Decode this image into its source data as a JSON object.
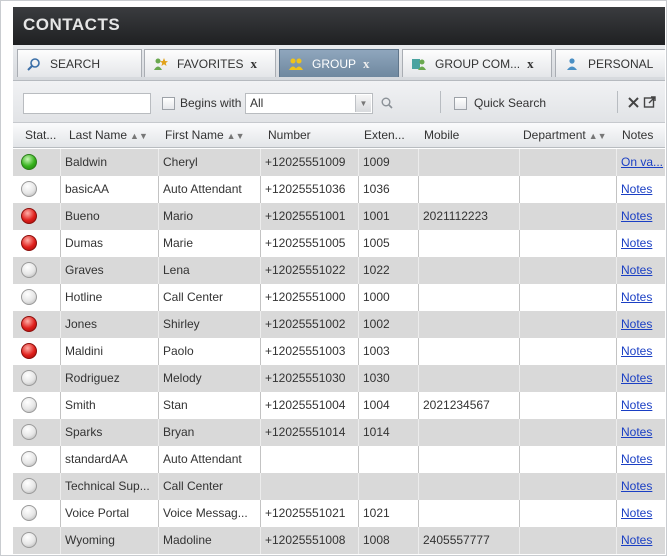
{
  "panel": {
    "title": "CONTACTS"
  },
  "tabs": [
    {
      "label": "SEARCH",
      "icon": "search-icon",
      "closable": false
    },
    {
      "label": "FAVORITES",
      "icon": "favorites-icon",
      "closable": true
    },
    {
      "label": "GROUP",
      "icon": "group-icon",
      "closable": true
    },
    {
      "label": "GROUP COM...",
      "icon": "group-common-icon",
      "closable": true
    },
    {
      "label": "PERSONAL",
      "icon": "personal-icon",
      "closable": false
    }
  ],
  "tab_close_glyph": "x",
  "toolbar": {
    "filter_value": "",
    "begins_with_label": "Begins with",
    "begins_with_value": "All",
    "quick_search_label": "Quick Search"
  },
  "columns": {
    "status": "Stat...",
    "last_name": "Last Name",
    "first_name": "First Name",
    "number": "Number",
    "extension": "Exten...",
    "mobile": "Mobile",
    "department": "Department",
    "notes": "Notes"
  },
  "rows": [
    {
      "status": "green",
      "last": "Baldwin",
      "first": "Cheryl",
      "number": "+12025551009",
      "ext": "1009",
      "mobile": "",
      "dept": "",
      "notes": "On va..."
    },
    {
      "status": "grey",
      "last": "basicAA",
      "first": "Auto Attendant",
      "number": "+12025551036",
      "ext": "1036",
      "mobile": "",
      "dept": "",
      "notes": "Notes"
    },
    {
      "status": "red",
      "last": "Bueno",
      "first": "Mario",
      "number": "+12025551001",
      "ext": "1001",
      "mobile": "2021112223",
      "dept": "",
      "notes": "Notes"
    },
    {
      "status": "red",
      "last": "Dumas",
      "first": "Marie",
      "number": "+12025551005",
      "ext": "1005",
      "mobile": "",
      "dept": "",
      "notes": "Notes"
    },
    {
      "status": "grey",
      "last": "Graves",
      "first": "Lena",
      "number": "+12025551022",
      "ext": "1022",
      "mobile": "",
      "dept": "",
      "notes": "Notes"
    },
    {
      "status": "grey",
      "last": "Hotline",
      "first": "Call Center",
      "number": "+12025551000",
      "ext": "1000",
      "mobile": "",
      "dept": "",
      "notes": "Notes"
    },
    {
      "status": "red",
      "last": "Jones",
      "first": "Shirley",
      "number": "+12025551002",
      "ext": "1002",
      "mobile": "",
      "dept": "",
      "notes": "Notes"
    },
    {
      "status": "red",
      "last": "Maldini",
      "first": "Paolo",
      "number": "+12025551003",
      "ext": "1003",
      "mobile": "",
      "dept": "",
      "notes": "Notes"
    },
    {
      "status": "grey",
      "last": "Rodriguez",
      "first": "Melody",
      "number": "+12025551030",
      "ext": "1030",
      "mobile": "",
      "dept": "",
      "notes": "Notes"
    },
    {
      "status": "grey",
      "last": "Smith",
      "first": "Stan",
      "number": "+12025551004",
      "ext": "1004",
      "mobile": "2021234567",
      "dept": "",
      "notes": "Notes"
    },
    {
      "status": "grey",
      "last": "Sparks",
      "first": "Bryan",
      "number": "+12025551014",
      "ext": "1014",
      "mobile": "",
      "dept": "",
      "notes": "Notes"
    },
    {
      "status": "grey",
      "last": "standardAA",
      "first": "Auto Attendant",
      "number": "",
      "ext": "",
      "mobile": "",
      "dept": "",
      "notes": "Notes"
    },
    {
      "status": "grey",
      "last": "Technical Sup...",
      "first": "Call Center",
      "number": "",
      "ext": "",
      "mobile": "",
      "dept": "",
      "notes": "Notes"
    },
    {
      "status": "grey",
      "last": "Voice Portal",
      "first": "Voice Messag...",
      "number": "+12025551021",
      "ext": "1021",
      "mobile": "",
      "dept": "",
      "notes": "Notes"
    },
    {
      "status": "grey",
      "last": "Wyoming",
      "first": "Madoline",
      "number": "+12025551008",
      "ext": "1008",
      "mobile": "2405557777",
      "dept": "",
      "notes": "Notes"
    }
  ],
  "colors": {
    "link": "#1a3fc4",
    "status_available": "#36b21c",
    "status_busy": "#e0201c",
    "status_offline": "#e6e6e6"
  }
}
